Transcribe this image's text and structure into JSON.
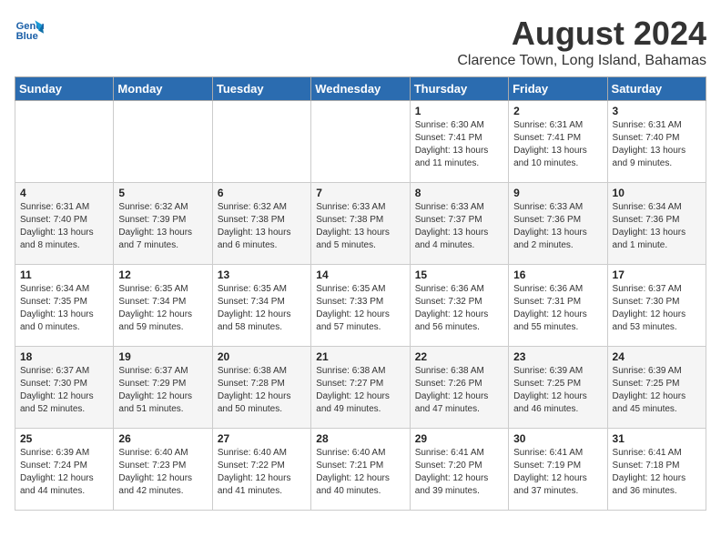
{
  "header": {
    "logo_line1": "General",
    "logo_line2": "Blue",
    "title": "August 2024",
    "subtitle": "Clarence Town, Long Island, Bahamas"
  },
  "weekdays": [
    "Sunday",
    "Monday",
    "Tuesday",
    "Wednesday",
    "Thursday",
    "Friday",
    "Saturday"
  ],
  "weeks": [
    [
      {
        "day": "",
        "info": ""
      },
      {
        "day": "",
        "info": ""
      },
      {
        "day": "",
        "info": ""
      },
      {
        "day": "",
        "info": ""
      },
      {
        "day": "1",
        "info": "Sunrise: 6:30 AM\nSunset: 7:41 PM\nDaylight: 13 hours and 11 minutes."
      },
      {
        "day": "2",
        "info": "Sunrise: 6:31 AM\nSunset: 7:41 PM\nDaylight: 13 hours and 10 minutes."
      },
      {
        "day": "3",
        "info": "Sunrise: 6:31 AM\nSunset: 7:40 PM\nDaylight: 13 hours and 9 minutes."
      }
    ],
    [
      {
        "day": "4",
        "info": "Sunrise: 6:31 AM\nSunset: 7:40 PM\nDaylight: 13 hours and 8 minutes."
      },
      {
        "day": "5",
        "info": "Sunrise: 6:32 AM\nSunset: 7:39 PM\nDaylight: 13 hours and 7 minutes."
      },
      {
        "day": "6",
        "info": "Sunrise: 6:32 AM\nSunset: 7:38 PM\nDaylight: 13 hours and 6 minutes."
      },
      {
        "day": "7",
        "info": "Sunrise: 6:33 AM\nSunset: 7:38 PM\nDaylight: 13 hours and 5 minutes."
      },
      {
        "day": "8",
        "info": "Sunrise: 6:33 AM\nSunset: 7:37 PM\nDaylight: 13 hours and 4 minutes."
      },
      {
        "day": "9",
        "info": "Sunrise: 6:33 AM\nSunset: 7:36 PM\nDaylight: 13 hours and 2 minutes."
      },
      {
        "day": "10",
        "info": "Sunrise: 6:34 AM\nSunset: 7:36 PM\nDaylight: 13 hours and 1 minute."
      }
    ],
    [
      {
        "day": "11",
        "info": "Sunrise: 6:34 AM\nSunset: 7:35 PM\nDaylight: 13 hours and 0 minutes."
      },
      {
        "day": "12",
        "info": "Sunrise: 6:35 AM\nSunset: 7:34 PM\nDaylight: 12 hours and 59 minutes."
      },
      {
        "day": "13",
        "info": "Sunrise: 6:35 AM\nSunset: 7:34 PM\nDaylight: 12 hours and 58 minutes."
      },
      {
        "day": "14",
        "info": "Sunrise: 6:35 AM\nSunset: 7:33 PM\nDaylight: 12 hours and 57 minutes."
      },
      {
        "day": "15",
        "info": "Sunrise: 6:36 AM\nSunset: 7:32 PM\nDaylight: 12 hours and 56 minutes."
      },
      {
        "day": "16",
        "info": "Sunrise: 6:36 AM\nSunset: 7:31 PM\nDaylight: 12 hours and 55 minutes."
      },
      {
        "day": "17",
        "info": "Sunrise: 6:37 AM\nSunset: 7:30 PM\nDaylight: 12 hours and 53 minutes."
      }
    ],
    [
      {
        "day": "18",
        "info": "Sunrise: 6:37 AM\nSunset: 7:30 PM\nDaylight: 12 hours and 52 minutes."
      },
      {
        "day": "19",
        "info": "Sunrise: 6:37 AM\nSunset: 7:29 PM\nDaylight: 12 hours and 51 minutes."
      },
      {
        "day": "20",
        "info": "Sunrise: 6:38 AM\nSunset: 7:28 PM\nDaylight: 12 hours and 50 minutes."
      },
      {
        "day": "21",
        "info": "Sunrise: 6:38 AM\nSunset: 7:27 PM\nDaylight: 12 hours and 49 minutes."
      },
      {
        "day": "22",
        "info": "Sunrise: 6:38 AM\nSunset: 7:26 PM\nDaylight: 12 hours and 47 minutes."
      },
      {
        "day": "23",
        "info": "Sunrise: 6:39 AM\nSunset: 7:25 PM\nDaylight: 12 hours and 46 minutes."
      },
      {
        "day": "24",
        "info": "Sunrise: 6:39 AM\nSunset: 7:25 PM\nDaylight: 12 hours and 45 minutes."
      }
    ],
    [
      {
        "day": "25",
        "info": "Sunrise: 6:39 AM\nSunset: 7:24 PM\nDaylight: 12 hours and 44 minutes."
      },
      {
        "day": "26",
        "info": "Sunrise: 6:40 AM\nSunset: 7:23 PM\nDaylight: 12 hours and 42 minutes."
      },
      {
        "day": "27",
        "info": "Sunrise: 6:40 AM\nSunset: 7:22 PM\nDaylight: 12 hours and 41 minutes."
      },
      {
        "day": "28",
        "info": "Sunrise: 6:40 AM\nSunset: 7:21 PM\nDaylight: 12 hours and 40 minutes."
      },
      {
        "day": "29",
        "info": "Sunrise: 6:41 AM\nSunset: 7:20 PM\nDaylight: 12 hours and 39 minutes."
      },
      {
        "day": "30",
        "info": "Sunrise: 6:41 AM\nSunset: 7:19 PM\nDaylight: 12 hours and 37 minutes."
      },
      {
        "day": "31",
        "info": "Sunrise: 6:41 AM\nSunset: 7:18 PM\nDaylight: 12 hours and 36 minutes."
      }
    ]
  ]
}
